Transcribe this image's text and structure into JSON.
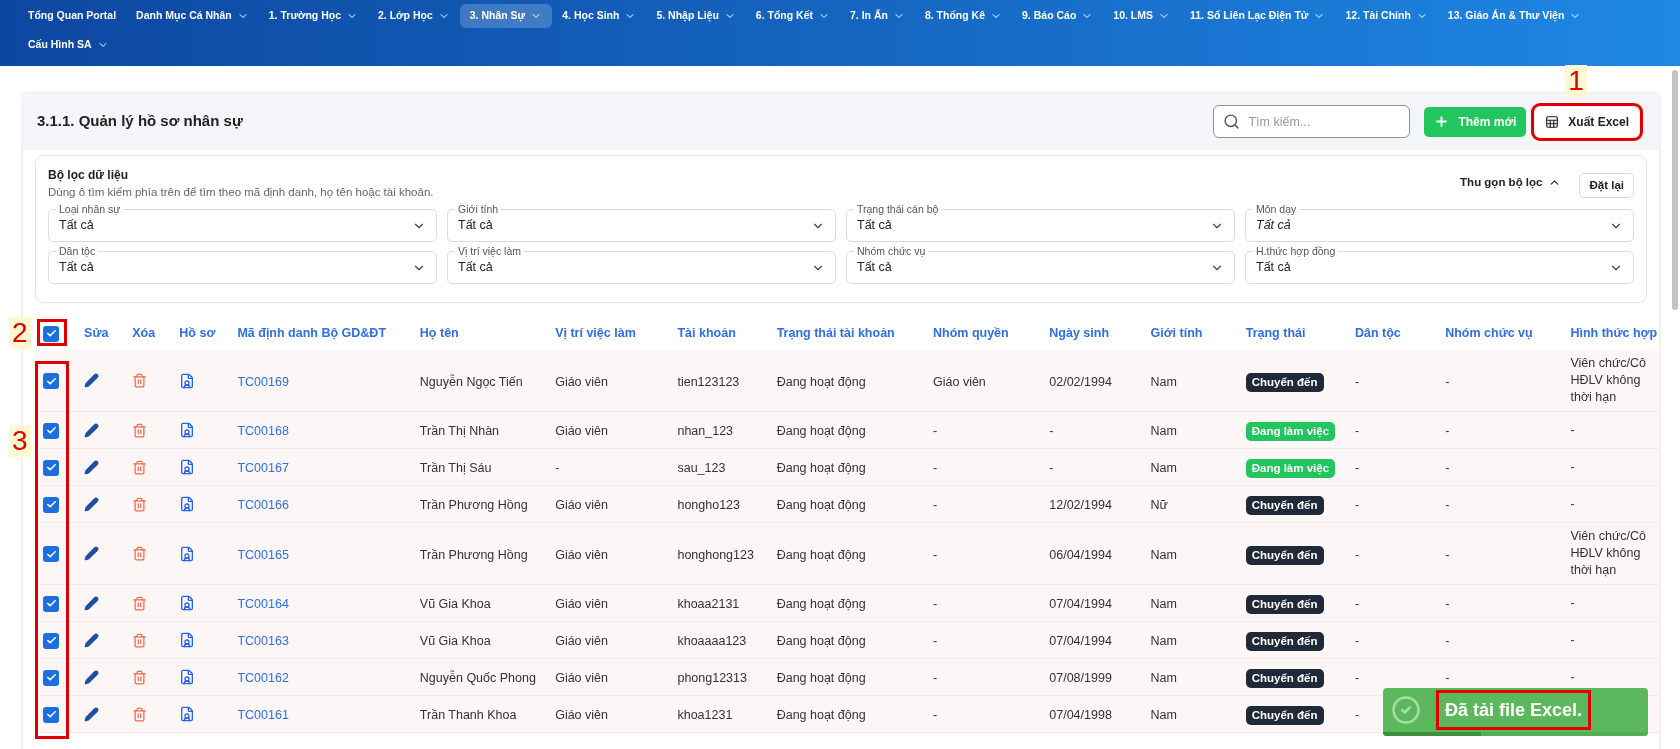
{
  "nav": {
    "items": [
      {
        "label": "Tổng Quan Portal",
        "has_menu": false,
        "selected": false
      },
      {
        "label": "Danh Mục Cá Nhân",
        "has_menu": true,
        "selected": false
      },
      {
        "label": "1. Trường Học",
        "has_menu": true,
        "selected": false
      },
      {
        "label": "2. Lớp Học",
        "has_menu": true,
        "selected": false
      },
      {
        "label": "3. Nhân Sự",
        "has_menu": true,
        "selected": true
      },
      {
        "label": "4. Học Sinh",
        "has_menu": true,
        "selected": false
      },
      {
        "label": "5. Nhập Liệu",
        "has_menu": true,
        "selected": false
      },
      {
        "label": "6. Tổng Kết",
        "has_menu": true,
        "selected": false
      },
      {
        "label": "7. In Ấn",
        "has_menu": true,
        "selected": false
      },
      {
        "label": "8. Thống Kê",
        "has_menu": true,
        "selected": false
      },
      {
        "label": "9. Báo Cáo",
        "has_menu": true,
        "selected": false
      },
      {
        "label": "10. LMS",
        "has_menu": true,
        "selected": false
      },
      {
        "label": "11. Sổ Liên Lạc Điện Tử",
        "has_menu": true,
        "selected": false
      },
      {
        "label": "12. Tài Chính",
        "has_menu": true,
        "selected": false
      },
      {
        "label": "13. Giáo Án & Thư Viện",
        "has_menu": true,
        "selected": false
      },
      {
        "label": "Cấu Hình SA",
        "has_menu": true,
        "selected": false
      }
    ]
  },
  "page": {
    "title": "3.1.1. Quản lý hồ sơ nhân sự",
    "search": {
      "placeholder": "Tìm kiếm..."
    },
    "buttons": [
      {
        "kind": "add",
        "label": "Thêm mới",
        "highlighted": false
      },
      {
        "kind": "export",
        "label": "Xuất Excel",
        "highlighted": true,
        "callout": "1"
      }
    ]
  },
  "filters": {
    "title": "Bộ lọc dữ liệu",
    "description": "Dùng ô tìm kiếm phía trên để tìm theo mã định danh, họ tên hoặc tài khoản.",
    "collapse_label": "Thu gọn bộ lọc",
    "reset_label": "Đặt lại",
    "fields": [
      {
        "label": "Loại nhân sự",
        "value": "Tất cả"
      },
      {
        "label": "Giới tính",
        "value": "Tất cả"
      },
      {
        "label": "Trạng thái cán bộ",
        "value": "Tất cả"
      },
      {
        "label": "Môn dạy",
        "placeholder": "Tất cả"
      },
      {
        "label": "Dân tộc",
        "value": "Tất cả"
      },
      {
        "label": "Vị trí việc làm",
        "value": "Tất cả"
      },
      {
        "label": "Nhóm chức vụ",
        "value": "Tất cả"
      },
      {
        "label": "H.thức hợp đồng",
        "value": "Tất cả"
      }
    ]
  },
  "table": {
    "select_all": {
      "checked": true,
      "highlighted": true,
      "callout": "2"
    },
    "rows_highlighted": true,
    "rows_callout": "3",
    "columns": [
      "Sửa",
      "Xóa",
      "Hồ sơ",
      "Mã định danh Bộ GD&ĐT",
      "Họ tên",
      "Vị trí việc làm",
      "Tài khoản",
      "Trạng thái tài khoản",
      "Nhóm quyền",
      "Ngày sinh",
      "Giới tính",
      "Trạng thái",
      "Dân tộc",
      "Nhóm chức vụ",
      "Hình thức hợp"
    ],
    "rows": [
      {
        "checked": true,
        "id": "TC00169",
        "name": "Nguyễn Ngọc Tiến",
        "position": "Giáo viên",
        "account": "tien123123",
        "account_status": "Đang hoạt động",
        "role": "Giáo viên",
        "birth_date": "02/02/1994",
        "gender": "Nam",
        "status": {
          "kind": "transferred",
          "label": "Chuyển đến"
        },
        "ethnicity": "-",
        "duty_group": "-",
        "contract": [
          "Viên chức/Cô",
          "HĐLV không",
          "thời hạn"
        ]
      },
      {
        "checked": true,
        "id": "TC00168",
        "name": "Trần Thị Nhàn",
        "position": "Giáo viên",
        "account": "nhan_123",
        "account_status": "Đang hoạt động",
        "role": "-",
        "birth_date": "-",
        "gender": "Nam",
        "status": {
          "kind": "working",
          "label": "Đang làm việc"
        },
        "ethnicity": "-",
        "duty_group": "-",
        "contract": [
          "-"
        ]
      },
      {
        "checked": true,
        "id": "TC00167",
        "name": "Trần Thị Sáu",
        "position": "-",
        "account": "sau_123",
        "account_status": "Đang hoạt động",
        "role": "-",
        "birth_date": "-",
        "gender": "Nam",
        "status": {
          "kind": "working",
          "label": "Đang làm việc"
        },
        "ethnicity": "-",
        "duty_group": "-",
        "contract": [
          "-"
        ]
      },
      {
        "checked": true,
        "id": "TC00166",
        "name": "Trần Phương Hồng",
        "position": "Giáo viên",
        "account": "hongho123",
        "account_status": "Đang hoạt động",
        "role": "-",
        "birth_date": "12/02/1994",
        "gender": "Nữ",
        "status": {
          "kind": "transferred",
          "label": "Chuyển đến"
        },
        "ethnicity": "-",
        "duty_group": "-",
        "contract": [
          "-"
        ]
      },
      {
        "checked": true,
        "id": "TC00165",
        "name": "Trần Phương Hồng",
        "position": "Giáo viên",
        "account": "honghong123",
        "account_status": "Đang hoạt động",
        "role": "-",
        "birth_date": "06/04/1994",
        "gender": "Nam",
        "status": {
          "kind": "transferred",
          "label": "Chuyển đến"
        },
        "ethnicity": "-",
        "duty_group": "-",
        "contract": [
          "Viên chức/Cô",
          "HĐLV không",
          "thời hạn"
        ]
      },
      {
        "checked": true,
        "id": "TC00164",
        "name": "Vũ Gia Khoa",
        "position": "Giáo viên",
        "account": "khoaa2131",
        "account_status": "Đang hoạt động",
        "role": "-",
        "birth_date": "07/04/1994",
        "gender": "Nam",
        "status": {
          "kind": "transferred",
          "label": "Chuyển đến"
        },
        "ethnicity": "-",
        "duty_group": "-",
        "contract": [
          "-"
        ]
      },
      {
        "checked": true,
        "id": "TC00163",
        "name": "Vũ Gia Khoa",
        "position": "Giáo viên",
        "account": "khoaaaa123",
        "account_status": "Đang hoạt động",
        "role": "-",
        "birth_date": "07/04/1994",
        "gender": "Nam",
        "status": {
          "kind": "transferred",
          "label": "Chuyển đến"
        },
        "ethnicity": "-",
        "duty_group": "-",
        "contract": [
          "-"
        ]
      },
      {
        "checked": true,
        "id": "TC00162",
        "name": "Nguyễn Quốc Phong",
        "position": "Giáo viên",
        "account": "phong12313",
        "account_status": "Đang hoạt động",
        "role": "-",
        "birth_date": "07/08/1999",
        "gender": "Nam",
        "status": {
          "kind": "transferred",
          "label": "Chuyển đến"
        },
        "ethnicity": "-",
        "duty_group": "-",
        "contract": [
          "-"
        ]
      },
      {
        "checked": true,
        "id": "TC00161",
        "name": "Trần Thanh Khoa",
        "position": "Giáo viên",
        "account": "khoa1231",
        "account_status": "Đang hoạt động",
        "role": "-",
        "birth_date": "07/04/1998",
        "gender": "Nam",
        "status": {
          "kind": "transferred",
          "label": "Chuyển đến"
        },
        "ethnicity": "-",
        "contract": []
      }
    ]
  },
  "toast": {
    "message": "Đã tải file Excel.",
    "highlighted": true,
    "level": 0.37
  }
}
